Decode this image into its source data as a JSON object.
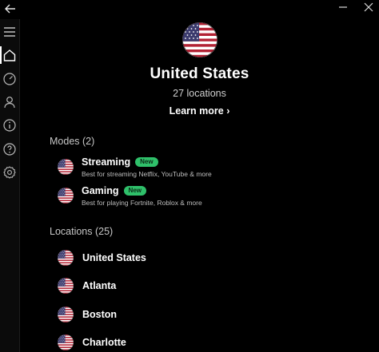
{
  "window": {
    "back_icon": "back-arrow-icon",
    "controls": [
      "minimize-icon",
      "close-icon"
    ]
  },
  "sidebar": {
    "items": [
      {
        "icon": "menu-icon"
      },
      {
        "icon": "home-icon",
        "active": true
      },
      {
        "icon": "speed-icon"
      },
      {
        "icon": "account-icon"
      },
      {
        "icon": "info-icon"
      },
      {
        "icon": "help-icon"
      },
      {
        "icon": "settings-icon"
      }
    ]
  },
  "hero": {
    "flag_icon": "us-flag-icon",
    "title": "United States",
    "locations_count": "27 locations",
    "learn_more": "Learn more ›"
  },
  "modes": {
    "label": "Modes (2)",
    "items": [
      {
        "name": "Streaming",
        "badge": "New",
        "desc": "Best for streaming Netflix, YouTube & more"
      },
      {
        "name": "Gaming",
        "badge": "New",
        "desc": "Best for playing Fortnite, Roblox & more"
      }
    ]
  },
  "locations": {
    "label": "Locations (25)",
    "items": [
      {
        "name": "United States"
      },
      {
        "name": "Atlanta"
      },
      {
        "name": "Boston"
      },
      {
        "name": "Charlotte"
      }
    ]
  },
  "colors": {
    "background": "#000000",
    "badge_green": "#2fc06a",
    "flag_red": "#b22234",
    "flag_blue": "#3c3b6e"
  }
}
